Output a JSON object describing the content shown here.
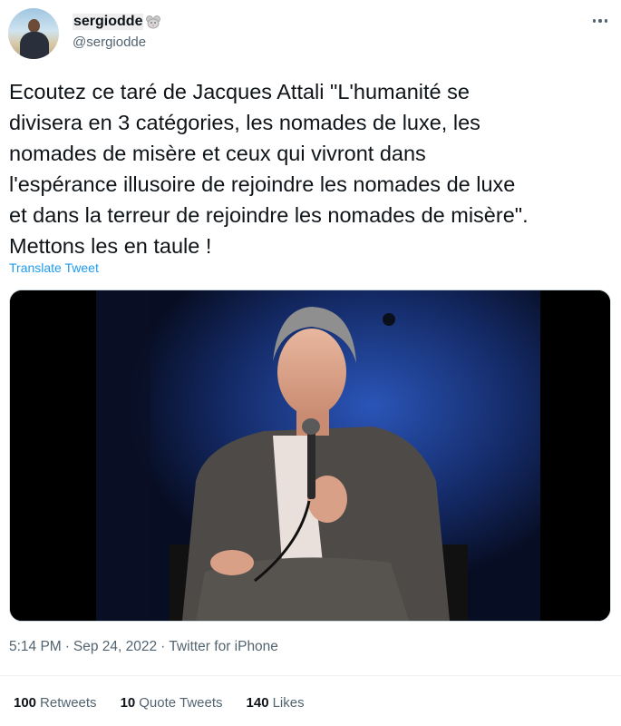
{
  "user": {
    "display_name": "sergiodde",
    "handle": "@sergiodde"
  },
  "tweet": {
    "text": "Ecoutez ce taré de Jacques Attali \"L'humanité se\ndivisera en 3 catégories, les nomades de luxe, les\nnomades de misère et ceux qui vivront dans\nl'espérance illusoire de rejoindre les nomades de luxe\net dans la terreur de rejoindre les nomades de misère\".\nMettons les en taule !",
    "translate_label": "Translate Tweet"
  },
  "meta": {
    "time": "5:14 PM",
    "date": "Sep 24, 2022",
    "source": "Twitter for iPhone"
  },
  "stats": {
    "retweets_count": "100",
    "retweets_label": "Retweets",
    "quotes_count": "10",
    "quotes_label": "Quote Tweets",
    "likes_count": "140",
    "likes_label": "Likes"
  },
  "icons": {
    "more": "more-horizontal-icon",
    "name_emoji": "mouse-emoji-icon"
  },
  "colors": {
    "text": "#0f1419",
    "secondary": "#536471",
    "link": "#1d9bf0",
    "border": "#cfd9de"
  }
}
